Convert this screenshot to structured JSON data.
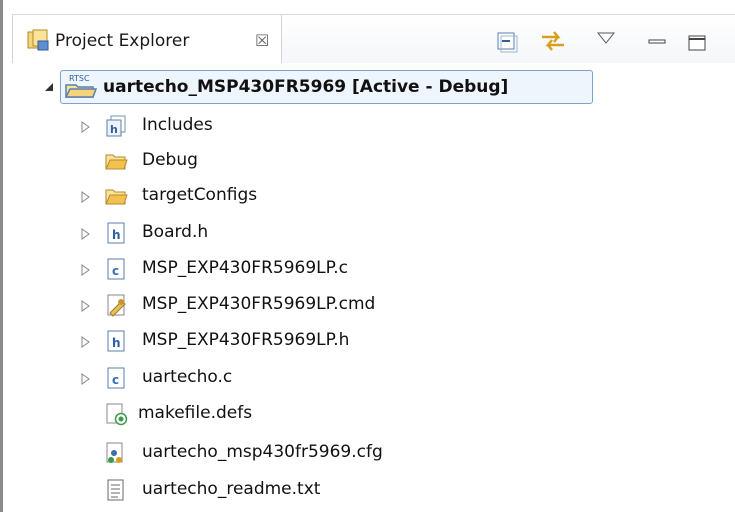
{
  "view": {
    "title": "Project Explorer",
    "close_glyph": "☒"
  },
  "toolbar": {
    "collapse_all_icon": "collapse-all-icon",
    "link_editor_icon": "link-with-editor-icon",
    "view_menu_icon": "view-menu-icon",
    "minimize_icon": "minimize-icon",
    "maximize_icon": "maximize-icon"
  },
  "project": {
    "badge": "RTSC",
    "label": "uartecho_MSP430FR5969  [Active - Debug]",
    "expanded": true
  },
  "items": [
    {
      "label": "Includes",
      "icon": "includes-icon",
      "expandable": true
    },
    {
      "label": "Debug",
      "icon": "folder-icon",
      "expandable": false
    },
    {
      "label": "targetConfigs",
      "icon": "folder-icon",
      "expandable": true
    },
    {
      "label": "Board.h",
      "icon": "header-file-icon",
      "expandable": true
    },
    {
      "label": "MSP_EXP430FR5969LP.c",
      "icon": "c-file-icon",
      "expandable": true
    },
    {
      "label": "MSP_EXP430FR5969LP.cmd",
      "icon": "cmd-file-icon",
      "expandable": true
    },
    {
      "label": "MSP_EXP430FR5969LP.h",
      "icon": "header-file-icon",
      "expandable": true
    },
    {
      "label": "uartecho.c",
      "icon": "c-file-icon",
      "expandable": true
    },
    {
      "label": "makefile.defs",
      "icon": "makefile-icon",
      "expandable": false
    },
    {
      "label": "uartecho_msp430fr5969.cfg",
      "icon": "cfg-file-icon",
      "expandable": false
    },
    {
      "label": "uartecho_readme.txt",
      "icon": "text-file-icon",
      "expandable": false
    }
  ],
  "colors": {
    "selection_border": "#7da2ce",
    "selection_fill": "#eef5fd",
    "folder": "#f2c14e",
    "c_file": "#3a6fb0"
  }
}
